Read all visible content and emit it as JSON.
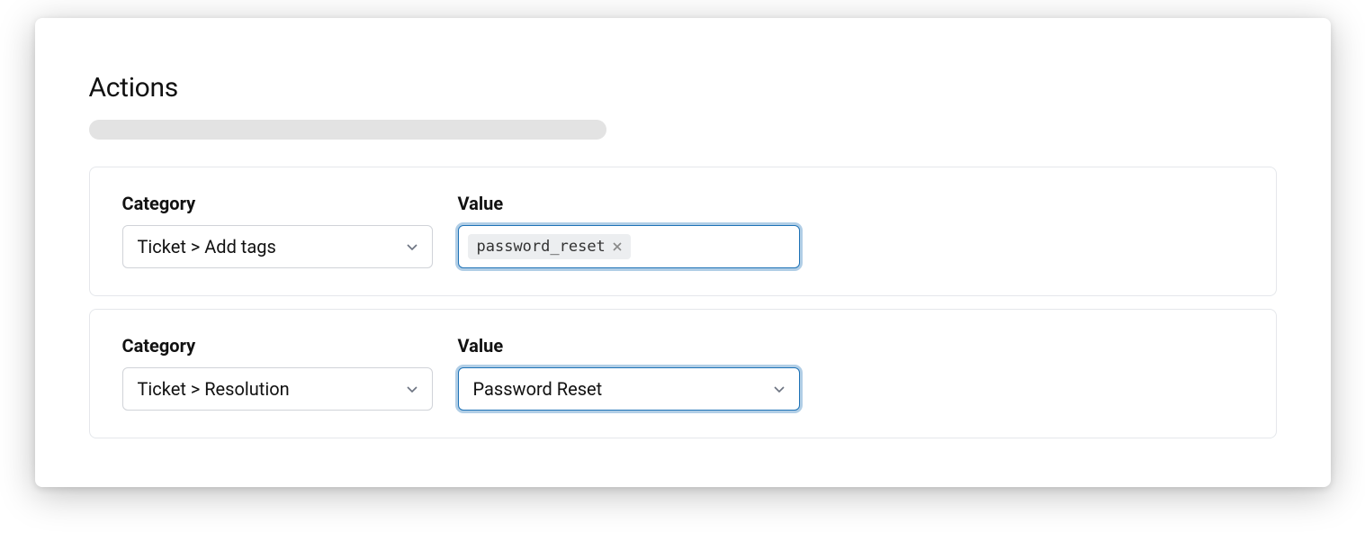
{
  "title": "Actions",
  "actions": [
    {
      "category_label": "Category",
      "category_value": "Ticket > Add tags",
      "value_label": "Value",
      "value_type": "tags",
      "value_tags": [
        "password_reset"
      ]
    },
    {
      "category_label": "Category",
      "category_value": "Ticket > Resolution",
      "value_label": "Value",
      "value_type": "select",
      "value_selected": "Password Reset"
    }
  ]
}
